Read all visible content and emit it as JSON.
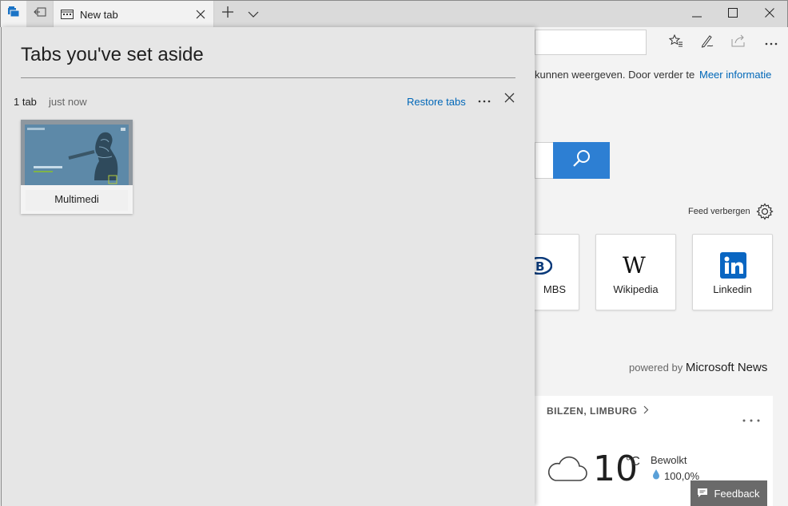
{
  "titlebar": {
    "tab_title": "New tab",
    "icons": [
      "tabs-aside-icon",
      "set-tabs-aside-icon",
      "new-tab-page-icon",
      "close-icon",
      "plus-icon",
      "chevron-down-icon",
      "minimize-icon",
      "maximize-icon",
      "close-window-icon"
    ]
  },
  "toolbar": {
    "icons": [
      "favorites-icon",
      "pen-icon",
      "share-icon",
      "more-icon"
    ]
  },
  "page": {
    "cookie_text": "kunnen weergeven. Door verder te",
    "cookie_link": "Meer informatie",
    "feed_hide": "Feed verbergen",
    "tiles": [
      {
        "label": "MBS",
        "icon": "nmbs-logo-icon"
      },
      {
        "label": "Wikipedia",
        "icon": "wikipedia-logo-icon"
      },
      {
        "label": "Linkedin",
        "icon": "linkedin-logo-icon"
      }
    ],
    "powered_prefix": "powered by",
    "powered_brand": "Microsoft News",
    "weather": {
      "location": "BILZEN, LIMBURG",
      "temperature": "10",
      "unit": "°C",
      "condition": "Bewolkt",
      "precipitation": "100,0%"
    },
    "feedback": "Feedback"
  },
  "panel": {
    "title": "Tabs you've set aside",
    "group_count": "1 tab",
    "group_time": "just now",
    "restore_label": "Restore tabs",
    "thumbnail_label": "Multimedi"
  },
  "colors": {
    "accent": "#0067b8",
    "search_button": "#2d7fd3",
    "panel_bg": "#e6e6e6"
  }
}
